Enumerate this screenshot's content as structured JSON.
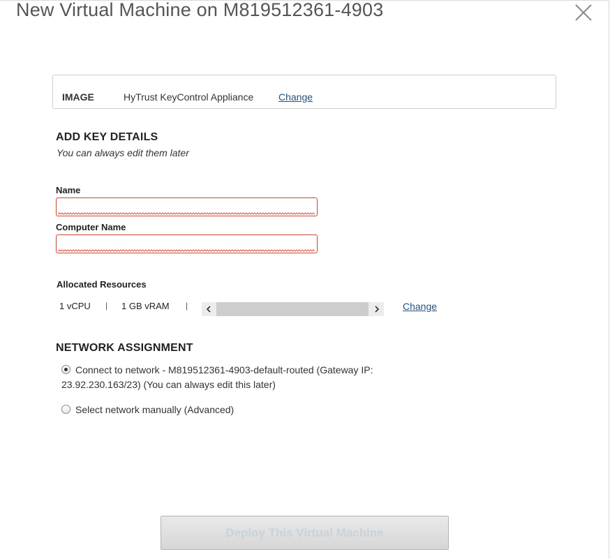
{
  "dialog": {
    "title": "New Virtual Machine on M819512361-4903"
  },
  "image": {
    "label": "IMAGE",
    "value": "HyTrust KeyControl Appliance",
    "change_label": "Change"
  },
  "key_details": {
    "heading": "ADD KEY DETAILS",
    "subtitle": "You can always edit them later",
    "name_label": "Name",
    "name_value": "",
    "computer_name_label": "Computer Name",
    "computer_name_value": ""
  },
  "resources": {
    "heading": "Allocated Resources",
    "cpu": "1 vCPU",
    "ram": "1 GB vRAM",
    "separator": "|",
    "change_label": "Change"
  },
  "network": {
    "heading": "NETWORK ASSIGNMENT",
    "option_connect_line1": "Connect to network - M819512361-4903-default-routed (Gateway IP:",
    "option_connect_line2": "23.92.230.163/23) (You can always edit this later)",
    "option_manual": "Select network manually (Advanced)",
    "selected": "connect"
  },
  "footer": {
    "deploy_label": "Deploy This Virtual Machine",
    "deploy_enabled": false
  },
  "colors": {
    "link": "#27507a",
    "error_border": "#c8462e",
    "disabled_text": "#c7d3dc"
  }
}
